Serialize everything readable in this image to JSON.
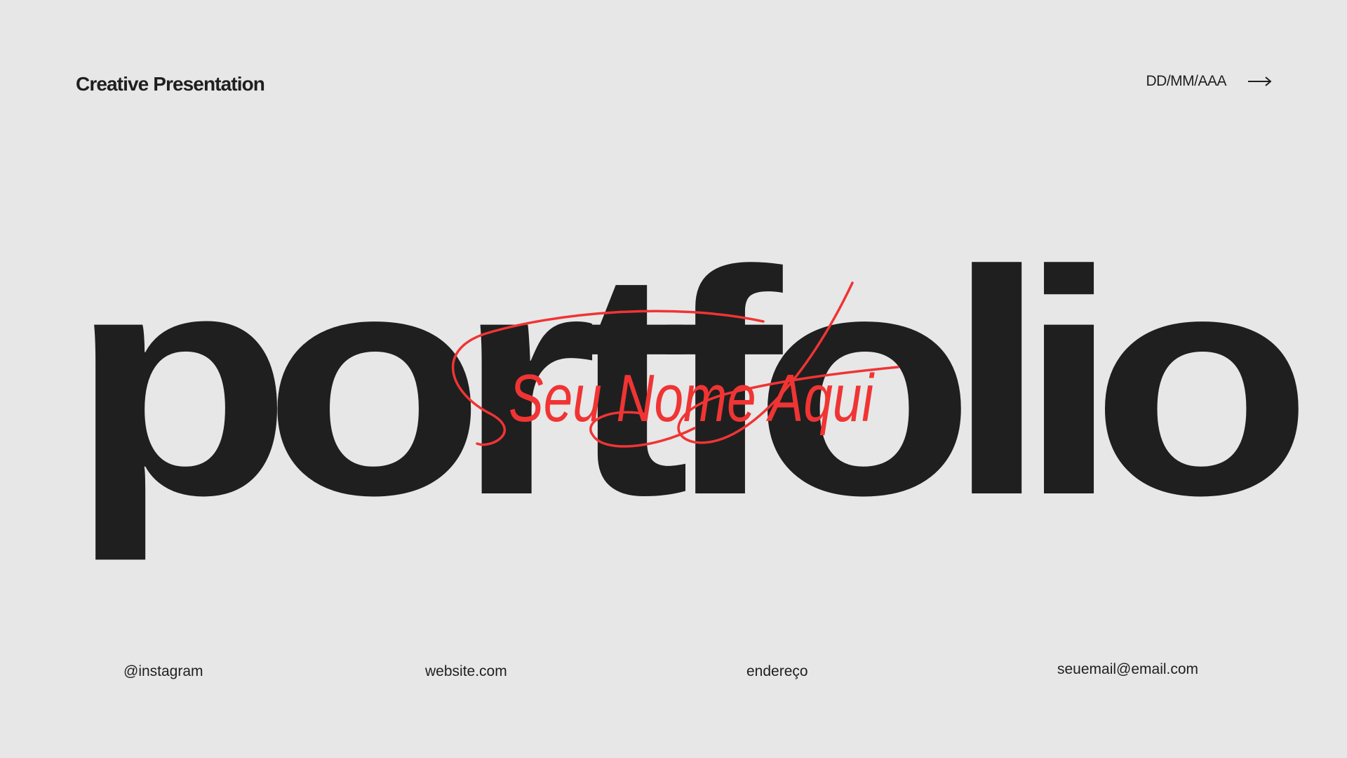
{
  "header": {
    "title": "Creative Presentation",
    "date": "DD/MM/AAA",
    "arrow_icon": "arrow-right-icon"
  },
  "hero": {
    "word": "portfolio",
    "signature": "Seu Nome Aqui"
  },
  "footer": {
    "instagram": "@instagram",
    "website": "website.com",
    "address": "endereço",
    "email": "seuemail@email.com"
  },
  "colors": {
    "background": "#e7e7e7",
    "text": "#1f1f1f",
    "accent": "#f03434"
  }
}
